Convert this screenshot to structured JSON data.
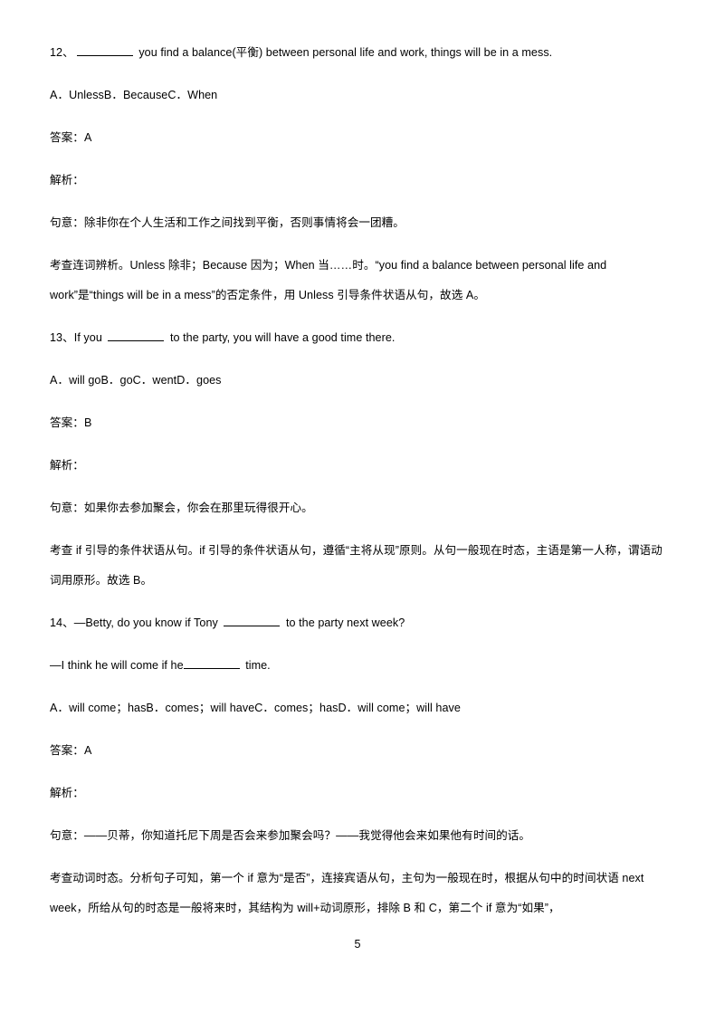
{
  "document": {
    "page_number": "5",
    "items": [
      {
        "number": "12、",
        "question_parts": [
          {
            "type": "blank"
          },
          {
            "type": "text",
            "value": " you find a balance(平衡) between personal life and work, things will be in a mess."
          }
        ],
        "question_plain": "12、________ you find a balance(平衡) between personal life and work, things will be in a mess.",
        "options": "A．UnlessB．BecauseC．When",
        "answer_label": "答案：",
        "answer_value": "A",
        "analysis_label": "解析：",
        "meaning": "句意：除非你在个人生活和工作之间找到平衡，否则事情将会一团糟。",
        "explanation": "考查连词辨析。Unless 除非；Because 因为；When 当……时。“you find a balance between personal life and work”是“things will be in a mess”的否定条件，用 Unless 引导条件状语从句，故选 A。"
      },
      {
        "number": "13、",
        "question_parts": [
          {
            "type": "text",
            "value": "If you "
          },
          {
            "type": "blank"
          },
          {
            "type": "text",
            "value": " to the party, you will have a good time there."
          }
        ],
        "question_plain": "13、If you ________ to the party, you will have a good time there.",
        "options": "A．will goB．goC．wentD．goes",
        "answer_label": "答案：",
        "answer_value": "B",
        "analysis_label": "解析：",
        "meaning": "句意：如果你去参加聚会，你会在那里玩得很开心。",
        "explanation": "考查 if 引导的条件状语从句。if 引导的条件状语从句，遵循“主将从现”原则。从句一般现在时态，主语是第一人称，谓语动词用原形。故选 B。"
      },
      {
        "number": "14、",
        "question_parts": [
          {
            "type": "text",
            "value": "—Betty, do you know if Tony "
          },
          {
            "type": "blank"
          },
          {
            "type": "text",
            "value": " to the party next week?"
          }
        ],
        "question_plain": "14、—Betty, do you know if Tony ________ to the party next week?",
        "question_line2_parts": [
          {
            "type": "text",
            "value": "—I think he will come if he"
          },
          {
            "type": "blank"
          },
          {
            "type": "text",
            "value": " time."
          }
        ],
        "question_line2_plain": "—I think he will come if he________ time.",
        "options": "A．will come；hasB．comes；will haveC．comes；hasD．will come；will have",
        "answer_label": "答案：",
        "answer_value": "A",
        "analysis_label": "解析：",
        "meaning": "句意：——贝蒂，你知道托尼下周是否会来参加聚会吗？——我觉得他会来如果他有时间的话。",
        "explanation": "考查动词时态。分析句子可知，第一个 if 意为“是否”，连接宾语从句，主句为一般现在时，根据从句中的时间状语 next week，所给从句的时态是一般将来时，其结构为 will+动词原形，排除 B 和 C，第二个 if 意为“如果”，"
      }
    ]
  }
}
